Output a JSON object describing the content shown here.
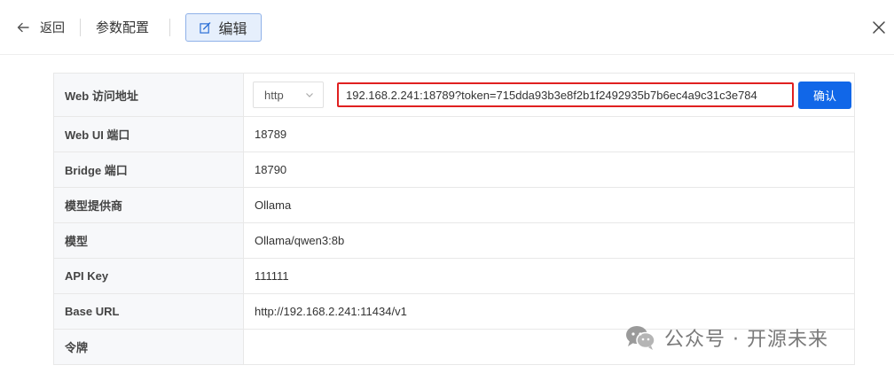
{
  "header": {
    "back_label": "返回",
    "title": "参数配置",
    "edit_label": "编辑"
  },
  "config": {
    "rows": [
      {
        "label": "Web 访问地址",
        "protocol": "http",
        "url_value": "192.168.2.241:18789?token=715dda93b3e8f2b1f2492935b7b6ec4a9c31c3e784",
        "confirm_label": "确认"
      },
      {
        "label": "Web UI 端口",
        "value": "18789"
      },
      {
        "label": "Bridge 端口",
        "value": "18790"
      },
      {
        "label": "模型提供商",
        "value": "Ollama"
      },
      {
        "label": "模型",
        "value": "Ollama/qwen3:8b"
      },
      {
        "label": "API Key",
        "value": "111111"
      },
      {
        "label": "Base URL",
        "value": "http://192.168.2.241:11434/v1"
      },
      {
        "label": "令牌",
        "value": ""
      }
    ]
  },
  "watermark": {
    "text": "公众号 · 开源未来",
    "icon": "wechat-icon"
  },
  "colors": {
    "primary": "#1167e8",
    "highlight_border": "#e02020",
    "label_bg": "#f7f8fa",
    "edit_bg": "#e6effc"
  }
}
